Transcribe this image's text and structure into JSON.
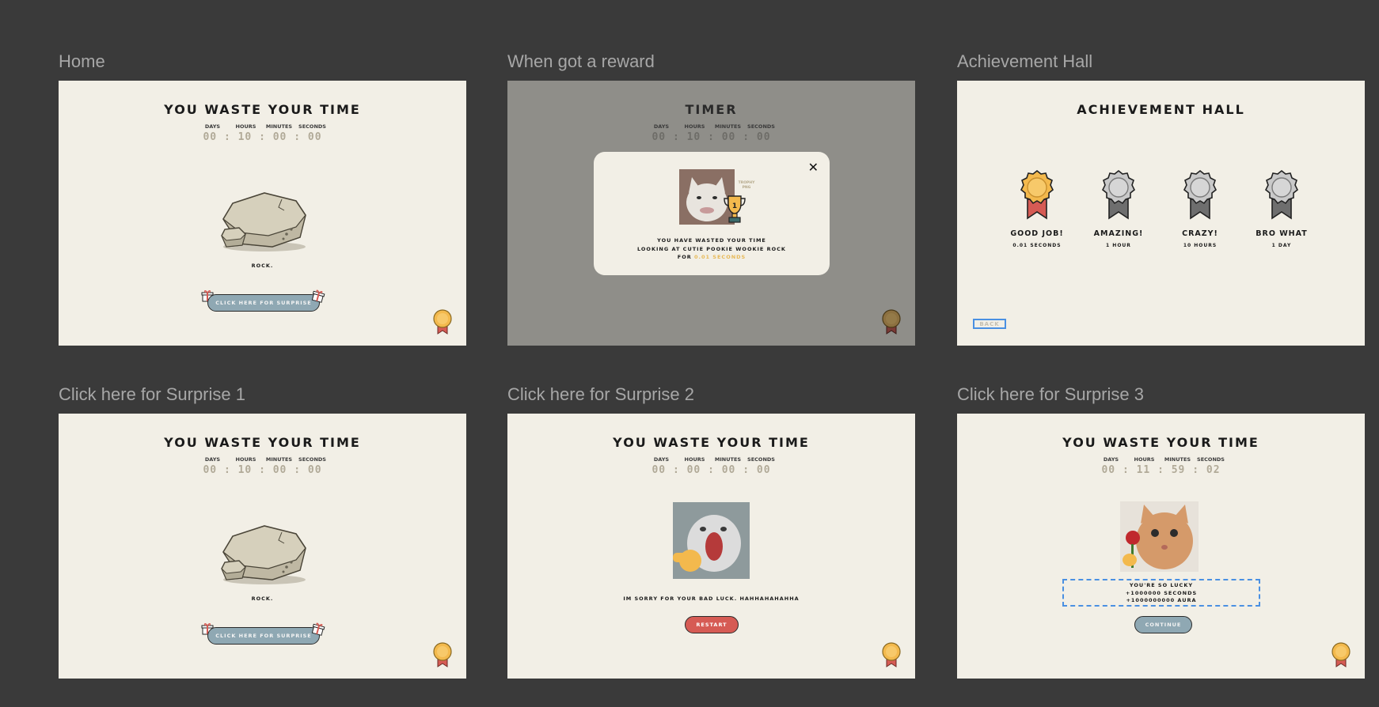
{
  "frames": {
    "home": {
      "title": "Home",
      "heading": "YOU WASTE YOUR TIME",
      "units": [
        "DAYS",
        "HOURS",
        "MINUTES",
        "SECONDS"
      ],
      "clock": "00 : 10 : 00 : 00",
      "caption": "ROCK.",
      "button": "CLICK HERE FOR SURPRISE"
    },
    "reward": {
      "title": "When got a reward",
      "heading": "TIMER",
      "units": [
        "DAYS",
        "HOURS",
        "MINUTES",
        "SECONDS"
      ],
      "clock": "00 : 10 : 00 : 00",
      "modal": {
        "line1": "YOU HAVE WASTED YOUR TIME",
        "line2": "LOOKING AT CUTIE POOKIE WOOKIE ROCK",
        "line3_prefix": "FOR",
        "line3_highlight": "0.01 SECONDS",
        "trophy_tag": "TROPHY PNG",
        "close_icon": "close-icon"
      }
    },
    "achievements": {
      "title": "Achievement Hall",
      "heading": "ACHIEVEMENT HALL",
      "items": [
        {
          "label": "GOOD JOB!",
          "sub": "0.01 SECONDS",
          "unlocked": true
        },
        {
          "label": "AMAZING!",
          "sub": "1 HOUR",
          "unlocked": false
        },
        {
          "label": "CRAZY!",
          "sub": "10 HOURS",
          "unlocked": false
        },
        {
          "label": "BRO WHAT",
          "sub": "1 DAY",
          "unlocked": false
        }
      ],
      "back": "BACK"
    },
    "surprise1": {
      "title": "Click here for Surprise 1",
      "heading": "YOU WASTE YOUR TIME",
      "units": [
        "DAYS",
        "HOURS",
        "MINUTES",
        "SECONDS"
      ],
      "clock": "00 : 10 : 00 : 00",
      "caption": "ROCK.",
      "button": "CLICK HERE FOR SURPRISE"
    },
    "surprise2": {
      "title": "Click here for Surprise 2",
      "heading": "YOU WASTE YOUR TIME",
      "units": [
        "DAYS",
        "HOURS",
        "MINUTES",
        "SECONDS"
      ],
      "clock": "00 : 00 : 00 : 00",
      "caption": "IM SORRY FOR YOUR BAD LUCK. HAHHAHAHAHHA",
      "button": "RESTART"
    },
    "surprise3": {
      "title": "Click here for Surprise 3",
      "heading": "YOU WASTE YOUR TIME",
      "units": [
        "DAYS",
        "HOURS",
        "MINUTES",
        "SECONDS"
      ],
      "clock": "00 : 11 : 59 : 02",
      "lucky": [
        "YOU'RE SO LUCKY",
        "+1000000 SECONDS",
        "+1000000000 AURA"
      ],
      "button": "CONTINUE"
    }
  },
  "colors": {
    "canvas": "#3a3a3a",
    "paper": "#f2efe6",
    "dimmed": "#8f8e89",
    "accent_gold": "#f3b94d",
    "button_blue": "#8fa8b3",
    "button_red": "#d65b54",
    "selection_blue": "#4a90e2"
  }
}
